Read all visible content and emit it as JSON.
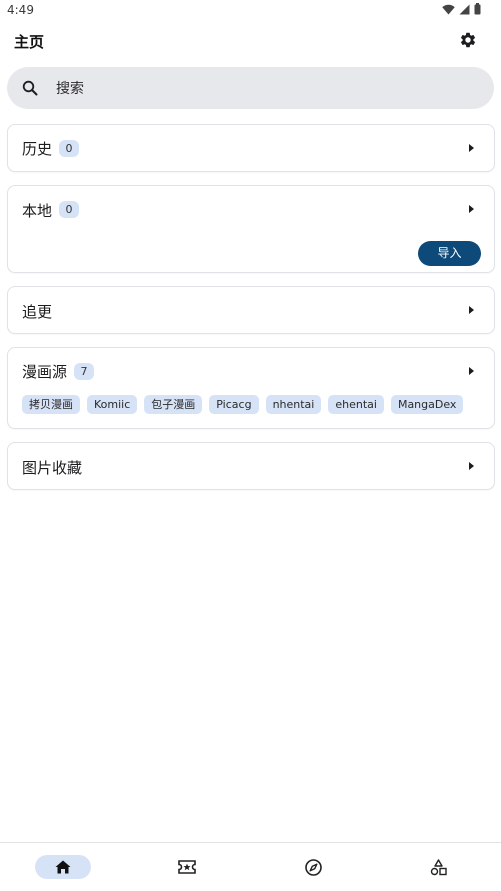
{
  "status_bar": {
    "time": "4:49",
    "icons": [
      "wifi-icon",
      "signal-icon",
      "battery-icon"
    ]
  },
  "app_bar": {
    "title": "主页",
    "settings_icon": "gear-icon"
  },
  "search": {
    "placeholder": "搜索",
    "icon": "search-icon"
  },
  "sections": {
    "history": {
      "title": "历史",
      "count": "0"
    },
    "local": {
      "title": "本地",
      "count": "0",
      "import_label": "导入"
    },
    "updates": {
      "title": "追更"
    },
    "sources": {
      "title": "漫画源",
      "count": "7",
      "tags": [
        "拷贝漫画",
        "Komiic",
        "包子漫画",
        "Picacg",
        "nhentai",
        "ehentai",
        "MangaDex"
      ]
    },
    "images": {
      "title": "图片收藏"
    }
  },
  "bottom_nav": {
    "items": [
      {
        "icon": "home-icon",
        "active": true
      },
      {
        "icon": "ticket-star-icon",
        "active": false
      },
      {
        "icon": "compass-icon",
        "active": false
      },
      {
        "icon": "shapes-icon",
        "active": false
      }
    ]
  },
  "colors": {
    "accent": "#0d4a7a",
    "badge_bg": "#d6e3f7",
    "search_bg": "#e7e8ec"
  }
}
